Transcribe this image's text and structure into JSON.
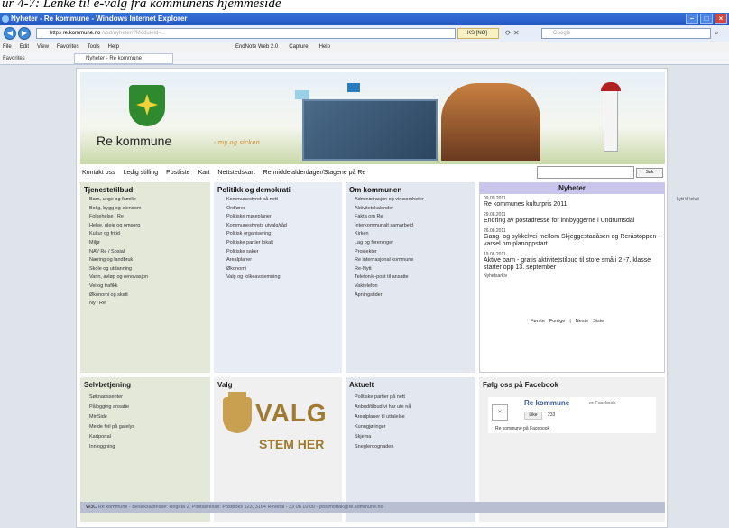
{
  "caption": "ur 4-7: Lenke til e-valg fra kommunens hjemmeside",
  "window": {
    "title": "Nyheter - Re kommune - Windows Internet Explorer"
  },
  "address": {
    "host": "re.kommune.no",
    "rest": "/vsd/nyheter/?ModuleId=...",
    "scheme": "https",
    "ssl": "KS [NO]",
    "search_placeholder": "Google"
  },
  "menu": {
    "items": [
      "File",
      "Edit",
      "View",
      "Favorites",
      "Tools",
      "Help"
    ],
    "ext": [
      "EndNote Web 2.0",
      "Capture",
      "Help"
    ]
  },
  "favbar": {
    "favorites": "Favorites",
    "tab": "Nyheter - Re kommune"
  },
  "logo": {
    "name": "Re kommune",
    "slogan": "- my og sicken"
  },
  "topnav": [
    "Kontakt oss",
    "Ledig stilling",
    "Postliste",
    "Kart",
    "Nettstedskart",
    "Re middelalderdager/Stagene på Re"
  ],
  "site_search": {
    "button": "Søk"
  },
  "tjenestetilbud": {
    "title": "Tjenestetilbud",
    "items": [
      "Barn, unge og familie",
      "Bolig, bygg og eiendom",
      "Folkehelse i Re",
      "Helse, pleie og omsorg",
      "Kultur og fritid",
      "Miljø",
      "NAV Re / Sosial",
      "Næring og landbruk",
      "Skole og utdanning",
      "Vann, avløp og renovasjon",
      "Vei og trafikk",
      "Økonomi og skatt",
      "Ny i Re"
    ]
  },
  "politikk": {
    "title": "Politikk og demokrati",
    "items": [
      "Kommunestyret på nett",
      "Ordfører",
      "Politiske møteplaner",
      "Kommunestyrets utvalg/råd",
      "Politisk organisering",
      "Politiske partier lokalt",
      "Politiske saker",
      "Arealplaner",
      "Økonomi",
      "Valg og folkeavstemning"
    ]
  },
  "om": {
    "title": "Om kommunen",
    "items": [
      "Administrasjon og virksomheter",
      "Aktivitetskalender",
      "Fakta om Re",
      "Interkommunalt samarbeid",
      "Kirken",
      "Lag og foreninger",
      "Prosjekter",
      "Re internasjonal kommune",
      "Re-Nytt",
      "Telefon/e-post til ansatte",
      "Vaktelefon",
      "Åpningstider"
    ]
  },
  "nyheter": {
    "title": "Nyheter",
    "items": [
      {
        "date": "09.09.2011",
        "title": "Re kommunes kulturpris 2011"
      },
      {
        "date": "29.08.2011",
        "title": "Endring av postadresse for innbyggerne i Undrumsdal"
      },
      {
        "date": "26.08.2011",
        "title": "Gang- og sykkelvei mellom Skjeggestadåsen og Reråstoppen - varsel om planoppstart"
      },
      {
        "date": "19.08.2011",
        "title": "Aktive barn - gratis aktivitetstilbud til store små i 2.-7. klasse starter opp 13. september"
      }
    ],
    "archive": "Nyhetsarkiv",
    "pager": [
      "Første",
      "Forrige",
      "|",
      "Neste",
      "Siste"
    ]
  },
  "selvbetjening": {
    "title": "Selvbetjening",
    "items": [
      "Søknadssenter",
      "Pålogging ansatte",
      "MinSide",
      "Melde feil på gatelys",
      "Kartportal",
      "Innloggning"
    ]
  },
  "valg": {
    "title": "Valg",
    "big": "VALG",
    "sub": "STEM HER"
  },
  "aktuelt": {
    "title": "Aktuelt",
    "items": [
      "Politiske partier på nett",
      "Anbud/tilbud vi har ute nå",
      "Arealplaner til uttalelse",
      "Kunngjøringer",
      "Skjema",
      "Sneglerdognaden"
    ]
  },
  "facebook": {
    "title": "Følg oss på Facebook",
    "name": "Re kommune",
    "on": "on Facebook",
    "like": "Like",
    "count": "233",
    "foot": "Re kommune på Facebook"
  },
  "footer": {
    "prefix": "W3C",
    "main": "Re kommune - Besøksadresse: Regata 2, Postadresse: Postboks 123, 3164 Revetal - 33 06 10 00 - postmottak@re.kommune.no"
  },
  "side_label": "Lytt til tekst"
}
